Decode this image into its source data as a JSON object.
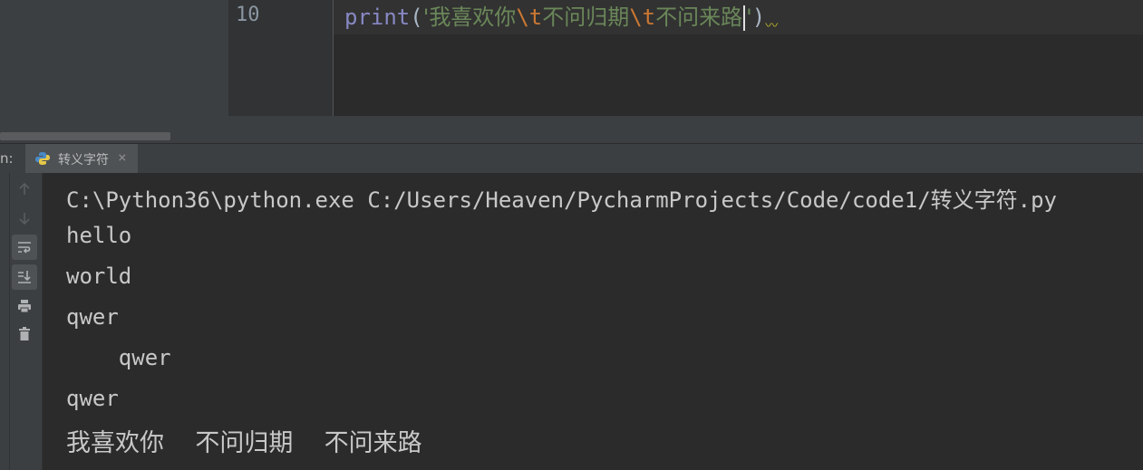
{
  "editor": {
    "line_number": "10",
    "code": {
      "func": "print",
      "open_paren": "(",
      "quote_open": "'",
      "seg1": "我喜欢你",
      "esc1": "\\t",
      "seg2": "不问归期",
      "esc2": "\\t",
      "seg3": "不问来路",
      "quote_close": "'",
      "close_paren": ")"
    }
  },
  "run_panel": {
    "label": "n:",
    "tab_label": "转义字符",
    "tab_close": "×"
  },
  "toolbar": {
    "icons": [
      "arrow-up-icon",
      "arrow-down-icon",
      "soft-wrap-icon",
      "scroll-to-end-icon",
      "print-icon",
      "trash-icon"
    ]
  },
  "console": {
    "lines": [
      "C:\\Python36\\python.exe C:/Users/Heaven/PycharmProjects/Code/code1/转义字符.py",
      "hello",
      "world",
      "qwer",
      "    qwer",
      "qwer",
      "我喜欢你    不问归期    不问来路"
    ]
  },
  "colors": {
    "keyword": "#8888c6",
    "string": "#6a8759",
    "escape": "#cc7832",
    "background": "#2b2b2b",
    "panel": "#3c3f41"
  }
}
